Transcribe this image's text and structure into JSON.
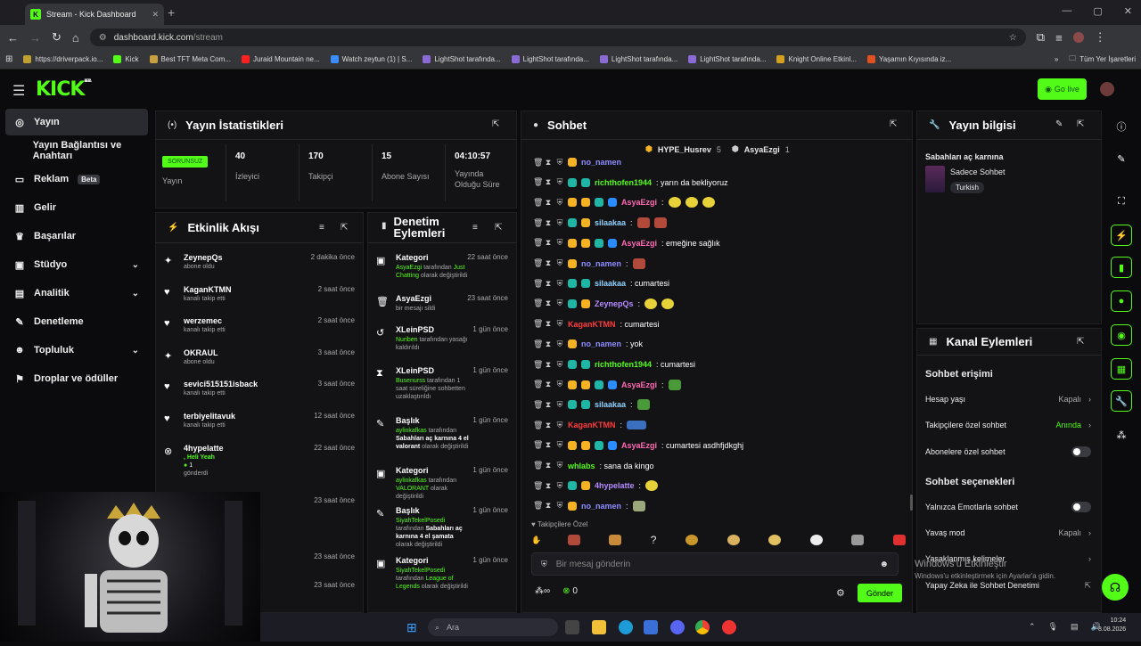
{
  "browser": {
    "tab_title": "Stream - Kick Dashboard",
    "url_host": "dashboard.kick.com",
    "url_path": "/stream",
    "bookmarks": [
      "https://driverpack.io...",
      "Kick",
      "Best TFT Meta Com...",
      "Juraid Mountain ne...",
      "Watch zeytun (1) | S...",
      "LightShot tarafında...",
      "LightShot tarafında...",
      "LightShot tarafında...",
      "LightShot tarafında...",
      "Knight Online Etkinl...",
      "Yaşamın Kıyısında iz..."
    ],
    "bookmarks_folder": "Tüm Yer İşaretleri"
  },
  "header": {
    "logo": "KICK",
    "logo_sup": "BETA",
    "go_live": "Go live"
  },
  "sidebar": {
    "items": [
      {
        "label": "Yayın"
      },
      {
        "label": "Yayın Bağlantısı ve Anahtarı"
      },
      {
        "label": "Reklam",
        "badge": "Beta"
      },
      {
        "label": "Gelir"
      },
      {
        "label": "Başarılar"
      },
      {
        "label": "Stüdyo"
      },
      {
        "label": "Analitik"
      },
      {
        "label": "Denetleme"
      },
      {
        "label": "Topluluk"
      },
      {
        "label": "Droplar ve ödüller"
      }
    ]
  },
  "stats": {
    "title": "Yayın İstatistikleri",
    "status": "SORUNSUZ",
    "status_label": "Yayın",
    "viewers": "40",
    "viewers_label": "İzleyici",
    "followers": "170",
    "followers_label": "Takipçi",
    "subs": "15",
    "subs_label": "Abone Sayısı",
    "uptime": "04:10:57",
    "uptime_label": "Yayında Olduğu Süre"
  },
  "activity": {
    "title": "Etkinlik Akışı",
    "events": [
      {
        "name": "ZeynepQs",
        "sub": "abone oldu",
        "time": "2 dakika önce"
      },
      {
        "name": "KaganKTMN",
        "sub": "kanalı takip etti",
        "time": "2 saat önce"
      },
      {
        "name": "werzemec",
        "sub": "kanalı takip etti",
        "time": "2 saat önce"
      },
      {
        "name": "OKRAUL",
        "sub": "abone oldu",
        "time": "3 saat önce"
      },
      {
        "name": "sevici515151isback",
        "sub": "kanalı takip etti",
        "time": "3 saat önce"
      },
      {
        "name": "terbiyelitavuk",
        "sub": "kanalı takip etti",
        "time": "12 saat önce"
      },
      {
        "name": "4hypelatte",
        "sub": ", Heli Yeah",
        "sub2": "1",
        "sub3": "gönderdi",
        "time": "22 saat önce"
      }
    ],
    "extra_times": [
      "23 saat önce",
      "23 saat önce",
      "23 saat önce"
    ]
  },
  "moderation": {
    "title_l1": "Denetim",
    "title_l2": "Eylemleri",
    "items": [
      {
        "name": "Kategori",
        "time": "22 saat önce",
        "actor": "AsyaEzgi",
        "mid": " tarafından ",
        "hl": "Just Chatting",
        "rest": " olarak değiştirildi"
      },
      {
        "name": "AsyaEzgi",
        "time": "23 saat önce",
        "rest": "bir mesajı sildi"
      },
      {
        "name": "XLeinPSD",
        "time": "1 gün önce",
        "actor": "Nuriben",
        "mid": " tarafından yasağı kaldırıldı"
      },
      {
        "name": "XLeinPSD",
        "time": "1 gün önce",
        "actor": "Busenurss",
        "mid": " tarafından 1 saat süreliğine sohbetten uzaklaştırıldı"
      },
      {
        "name": "Başlık",
        "time": "1 gün önce",
        "actor": "aylinkafkas",
        "mid": " tarafından ",
        "hl": "Sabahları aç karnına 4 el valorant",
        "rest": " olarak değiştirildi"
      },
      {
        "name": "Kategori",
        "time": "1 gün önce",
        "actor": "aylinkafkas",
        "mid": " tarafından ",
        "hl": "VALORANT",
        "rest": " olarak değiştirildi"
      },
      {
        "name": "Başlık",
        "time": "1 gün önce",
        "actor": "SiyahTekelPosedi",
        "mid": " tarafından ",
        "hl": "Sabahları aç karnına 4 el şamata",
        "rest": " olarak değiştirildi"
      },
      {
        "name": "Kategori",
        "time": "1 gün önce",
        "actor": "SiyahTekelPosedi",
        "mid": " tarafından ",
        "hl": "League of Legends",
        "rest": " olarak değiştirildi"
      }
    ]
  },
  "chat": {
    "title": "Sohbet",
    "pinned": [
      {
        "name": "HYPE_Husrev",
        "count": "5"
      },
      {
        "name": "AsyaEzgi",
        "count": "1"
      }
    ],
    "messages": [
      {
        "user": "no_namen",
        "color": "#8f8cff",
        "text": ""
      },
      {
        "user": "richthofen1944",
        "color": "#53fc18",
        "text": ": yarın da bekliyoruz"
      },
      {
        "user": "AsyaEzgi",
        "color": "#ff69b4",
        "text": ":"
      },
      {
        "user": "silaakaa",
        "color": "#8fd3ff",
        "text": ":"
      },
      {
        "user": "AsyaEzgi",
        "color": "#ff69b4",
        "text": ": emeğine sağlık"
      },
      {
        "user": "no_namen",
        "color": "#8f8cff",
        "text": ":"
      },
      {
        "user": "silaakaa",
        "color": "#8fd3ff",
        "text": ": cumartesi"
      },
      {
        "user": "ZeynepQs",
        "color": "#b48cff",
        "text": ":"
      },
      {
        "user": "KaganKTMN",
        "color": "#ff3b3b",
        "text": ": cumartesi"
      },
      {
        "user": "no_namen",
        "color": "#8f8cff",
        "text": ": yok"
      },
      {
        "user": "richthofen1944",
        "color": "#53fc18",
        "text": ": cumartesi"
      },
      {
        "user": "AsyaEzgi",
        "color": "#ff69b4",
        "text": ":"
      },
      {
        "user": "silaakaa",
        "color": "#8fd3ff",
        "text": ":"
      },
      {
        "user": "KaganKTMN",
        "color": "#ff3b3b",
        "text": ":"
      },
      {
        "user": "AsyaEzgi",
        "color": "#ff69b4",
        "text": ": cumartesi asdhfjdkghj"
      },
      {
        "user": "whlabs",
        "color": "#53fc18",
        "text": ": sana da kingo"
      },
      {
        "user": "4hypelatte",
        "color": "#b48cff",
        "text": ":"
      },
      {
        "user": "no_namen",
        "color": "#8f8cff",
        "text": ":"
      }
    ],
    "followers_only_label": "Takipçilere Özel",
    "input_placeholder": "Bir mesaj gönderin",
    "send": "Gönder",
    "points": "0"
  },
  "stream_info": {
    "title": "Yayın bilgisi",
    "stream_title": "Sabahları aç karnına",
    "category": "Sadece Sohbet",
    "language": "Turkish"
  },
  "channel_actions": {
    "title": "Kanal Eylemleri",
    "section1": "Sohbet erişimi",
    "account_age": "Hesap yaşı",
    "account_age_val": "Kapalı",
    "followers_chat": "Takipçilere özel sohbet",
    "followers_chat_val": "Anında",
    "subs_chat": "Abonelere özel sohbet",
    "section2": "Sohbet seçenekleri",
    "emote_only": "Yalnızca Emotlarla sohbet",
    "slow_mode": "Yavaş mod",
    "slow_mode_val": "Kapalı",
    "banned_words": "Yasaklanmış kelimeler",
    "ai_mod": "Yapay Zeka ile Sohbet Denetimi"
  },
  "os": {
    "watermark_l1": "Windows'u Etkinleştir",
    "watermark_l2": "Windows'u etkinleştirmek için Ayarlar'a gidin.",
    "search": "Ara",
    "time": "10:24",
    "date": "8.08.2026"
  },
  "colors": {
    "accent": "#53fc18",
    "bg": "#0b0b0d",
    "panel": "#131316"
  }
}
